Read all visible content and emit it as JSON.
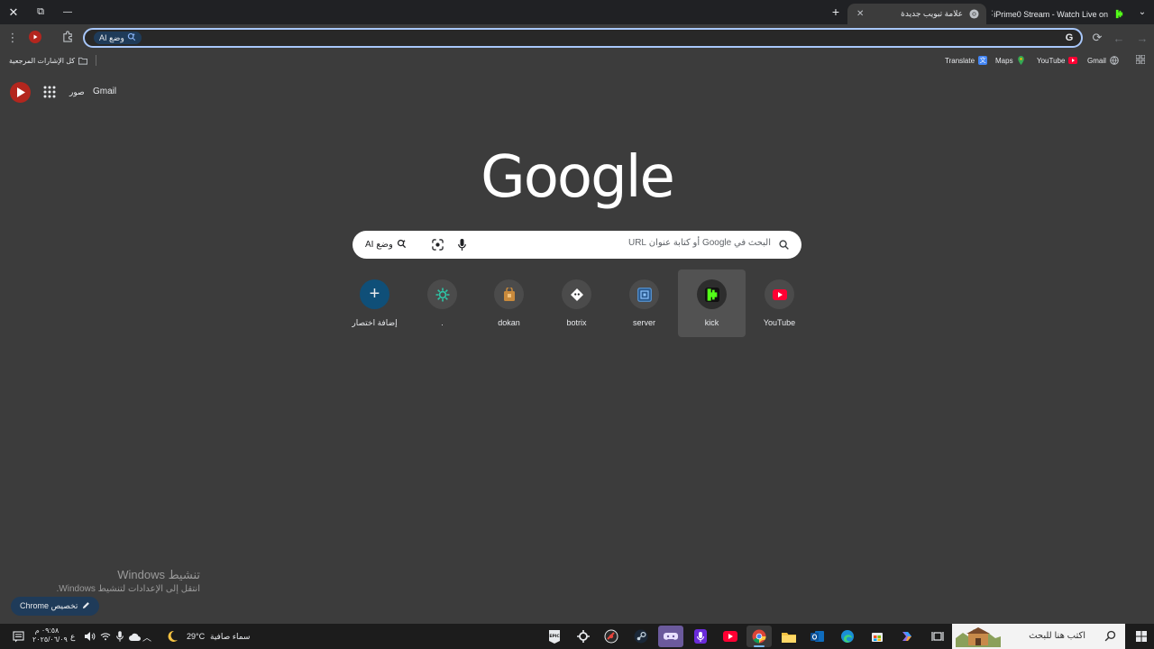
{
  "window": {
    "close": "✕",
    "restore": "⧉",
    "minimize": "—"
  },
  "tabs": [
    {
      "title": "iPrime0 Stream - Watch Live on",
      "favicon": "kick-icon",
      "active": false
    },
    {
      "title": "علامة تبويب جديدة",
      "favicon": "chrome-icon",
      "active": true
    }
  ],
  "toolbar": {
    "back": "←",
    "forward": "→",
    "reload": "⟳"
  },
  "omnibox": {
    "ai_chip": "وضع AI",
    "value": ""
  },
  "bookmarks": {
    "items": [
      {
        "label": "Translate",
        "icon": "translate-icon"
      },
      {
        "label": "Maps",
        "icon": "maps-icon"
      },
      {
        "label": "YouTube",
        "icon": "youtube-icon"
      },
      {
        "label": "Gmail",
        "icon": "gmail-icon"
      }
    ],
    "all_bookmarks": "كل الإشارات المرجعية"
  },
  "ntp": {
    "gmail": "Gmail",
    "images": "صور",
    "logo": "Google",
    "search_placeholder": "البحث في Google أو كتابة عنوان URL",
    "ai_mode": "وضع AI",
    "shortcuts": [
      {
        "label": "YouTube",
        "icon": "youtube-icon"
      },
      {
        "label": "kick",
        "icon": "kick-icon"
      },
      {
        "label": "server",
        "icon": "server-icon"
      },
      {
        "label": "botrix",
        "icon": "botrix-icon"
      },
      {
        "label": "dokan",
        "icon": "dokan-icon"
      },
      {
        "label": ".",
        "icon": "gear-icon"
      },
      {
        "label": "إضافة اختصار",
        "icon": "plus-icon"
      }
    ],
    "activation_title": "تنشيط Windows",
    "activation_sub": "انتقل إلى الإعدادات لتنشيط Windows.",
    "customize": "تخصيص Chrome"
  },
  "taskbar": {
    "search_placeholder": "اكتب هنا للبحث",
    "weather_temp": "29°C",
    "weather_text": "سماء صافية",
    "lang": "ع",
    "time": "٠٩:٥٨ م",
    "date": "٢٠٢٥/٠٦/٠٩"
  }
}
